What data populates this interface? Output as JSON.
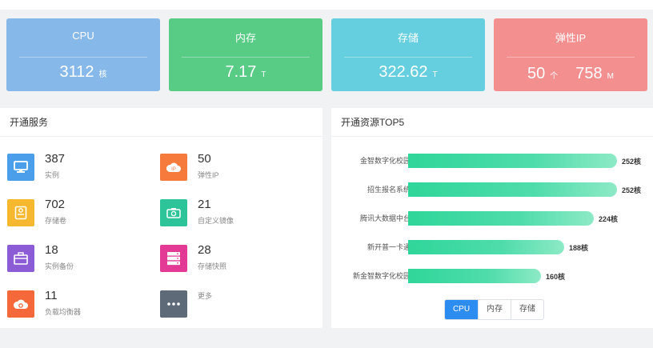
{
  "colors": {
    "cpu": "#86b9ea",
    "memory": "#58cb85",
    "storage": "#65cfe0",
    "eip": "#f48f8f",
    "bar": "#2fd69a",
    "active_tab": "#2d8cf0"
  },
  "stats": {
    "cpu": {
      "title": "CPU",
      "value": "3112",
      "unit": "核"
    },
    "memory": {
      "title": "内存",
      "value": "7.17",
      "unit": "T"
    },
    "storage": {
      "title": "存储",
      "value": "322.62",
      "unit": "T"
    },
    "eip": {
      "title": "弹性IP",
      "value1": "50",
      "unit1": "个",
      "value2": "758",
      "unit2": "M"
    }
  },
  "services": {
    "title": "开通服务",
    "items": [
      {
        "count": "387",
        "label": "实例",
        "icon": "monitor-icon"
      },
      {
        "count": "50",
        "label": "弹性IP",
        "icon": "cloud-icon"
      },
      {
        "count": "702",
        "label": "存储卷",
        "icon": "disk-icon"
      },
      {
        "count": "21",
        "label": "自定义镜像",
        "icon": "camera-icon"
      },
      {
        "count": "18",
        "label": "实例备份",
        "icon": "briefcase-icon"
      },
      {
        "count": "28",
        "label": "存储快照",
        "icon": "server-icon"
      },
      {
        "count": "11",
        "label": "负载均衡器",
        "icon": "cloud-gear-icon"
      },
      {
        "count": "",
        "label": "更多",
        "icon": "more-icon"
      }
    ]
  },
  "top5": {
    "title": "开通资源TOP5",
    "tabs": [
      "CPU",
      "内存",
      "存储"
    ],
    "active_tab": "CPU"
  },
  "chart_data": {
    "type": "bar",
    "orientation": "horizontal",
    "categories": [
      "金智数字化校园",
      "招生报名系统",
      "腾讯大数据中台",
      "新开普一卡通",
      "新金智数字化校园"
    ],
    "values": [
      252,
      252,
      224,
      188,
      160
    ],
    "labels": [
      "252核",
      "252核",
      "224核",
      "188核",
      "160核"
    ],
    "xlim": [
      0,
      270
    ],
    "grid": false
  }
}
